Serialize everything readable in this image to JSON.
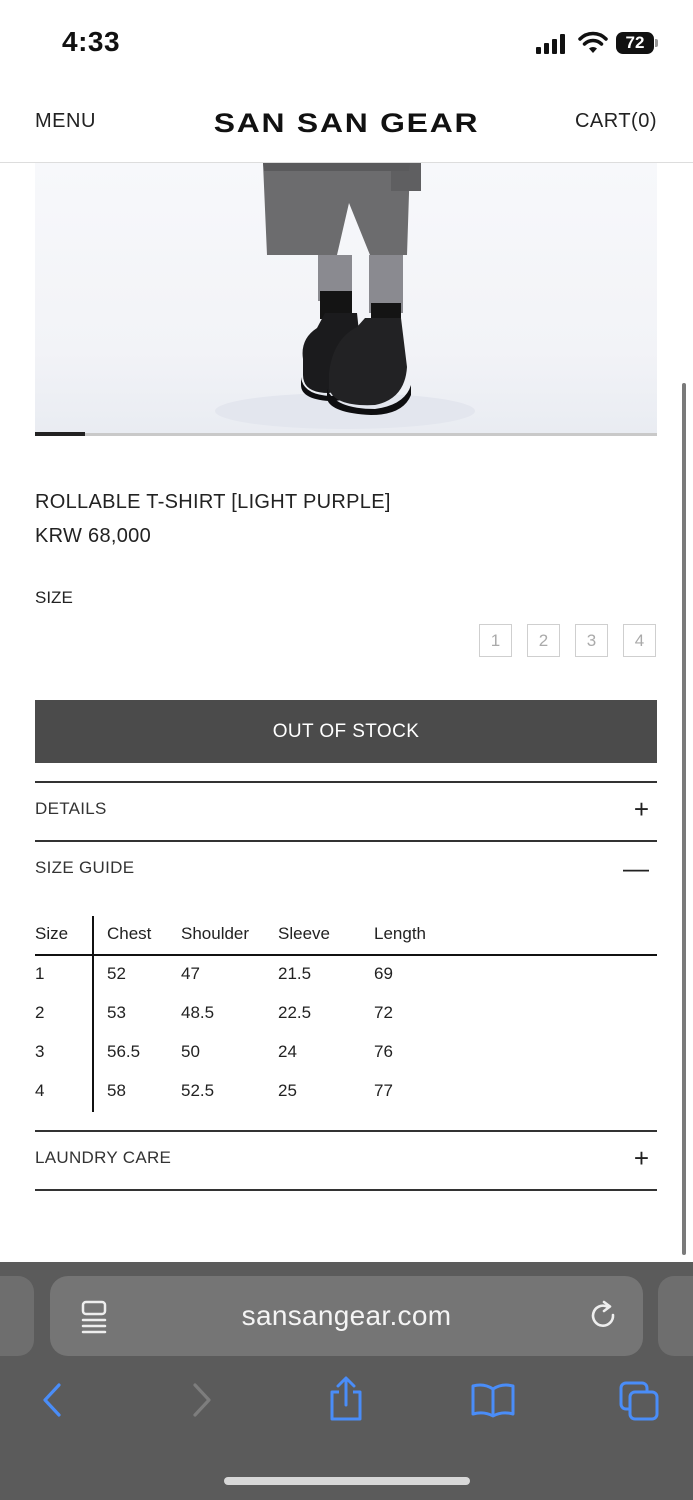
{
  "status_bar": {
    "time": "4:33",
    "battery": "72"
  },
  "header": {
    "menu": "MENU",
    "brand": "SAN SAN GEAR",
    "cart": "CART(0)"
  },
  "gallery": {
    "progress": 0.08
  },
  "product": {
    "title": "ROLLABLE T-SHIRT [LIGHT PURPLE]",
    "price": "KRW 68,000",
    "size_label": "SIZE",
    "sizes": [
      "1",
      "2",
      "3",
      "4"
    ],
    "stock_button": "OUT OF STOCK"
  },
  "sections": {
    "details": {
      "label": "DETAILS",
      "icon": "+"
    },
    "size_guide": {
      "label": "SIZE GUIDE",
      "icon": "—"
    },
    "laundry": {
      "label": "LAUNDRY CARE",
      "icon": "+"
    }
  },
  "size_table": {
    "headers": [
      "Size",
      "Chest",
      "Shoulder",
      "Sleeve",
      "Length"
    ],
    "rows": [
      [
        "1",
        "52",
        "47",
        "21.5",
        "69"
      ],
      [
        "2",
        "53",
        "48.5",
        "22.5",
        "72"
      ],
      [
        "3",
        "56.5",
        "50",
        "24",
        "76"
      ],
      [
        "4",
        "58",
        "52.5",
        "25",
        "77"
      ]
    ]
  },
  "browser": {
    "url": "sansangear.com"
  },
  "colors": {
    "accent": "#4a8df8",
    "button": "#4b4b4b",
    "toolbar": "#5b5b5b"
  }
}
